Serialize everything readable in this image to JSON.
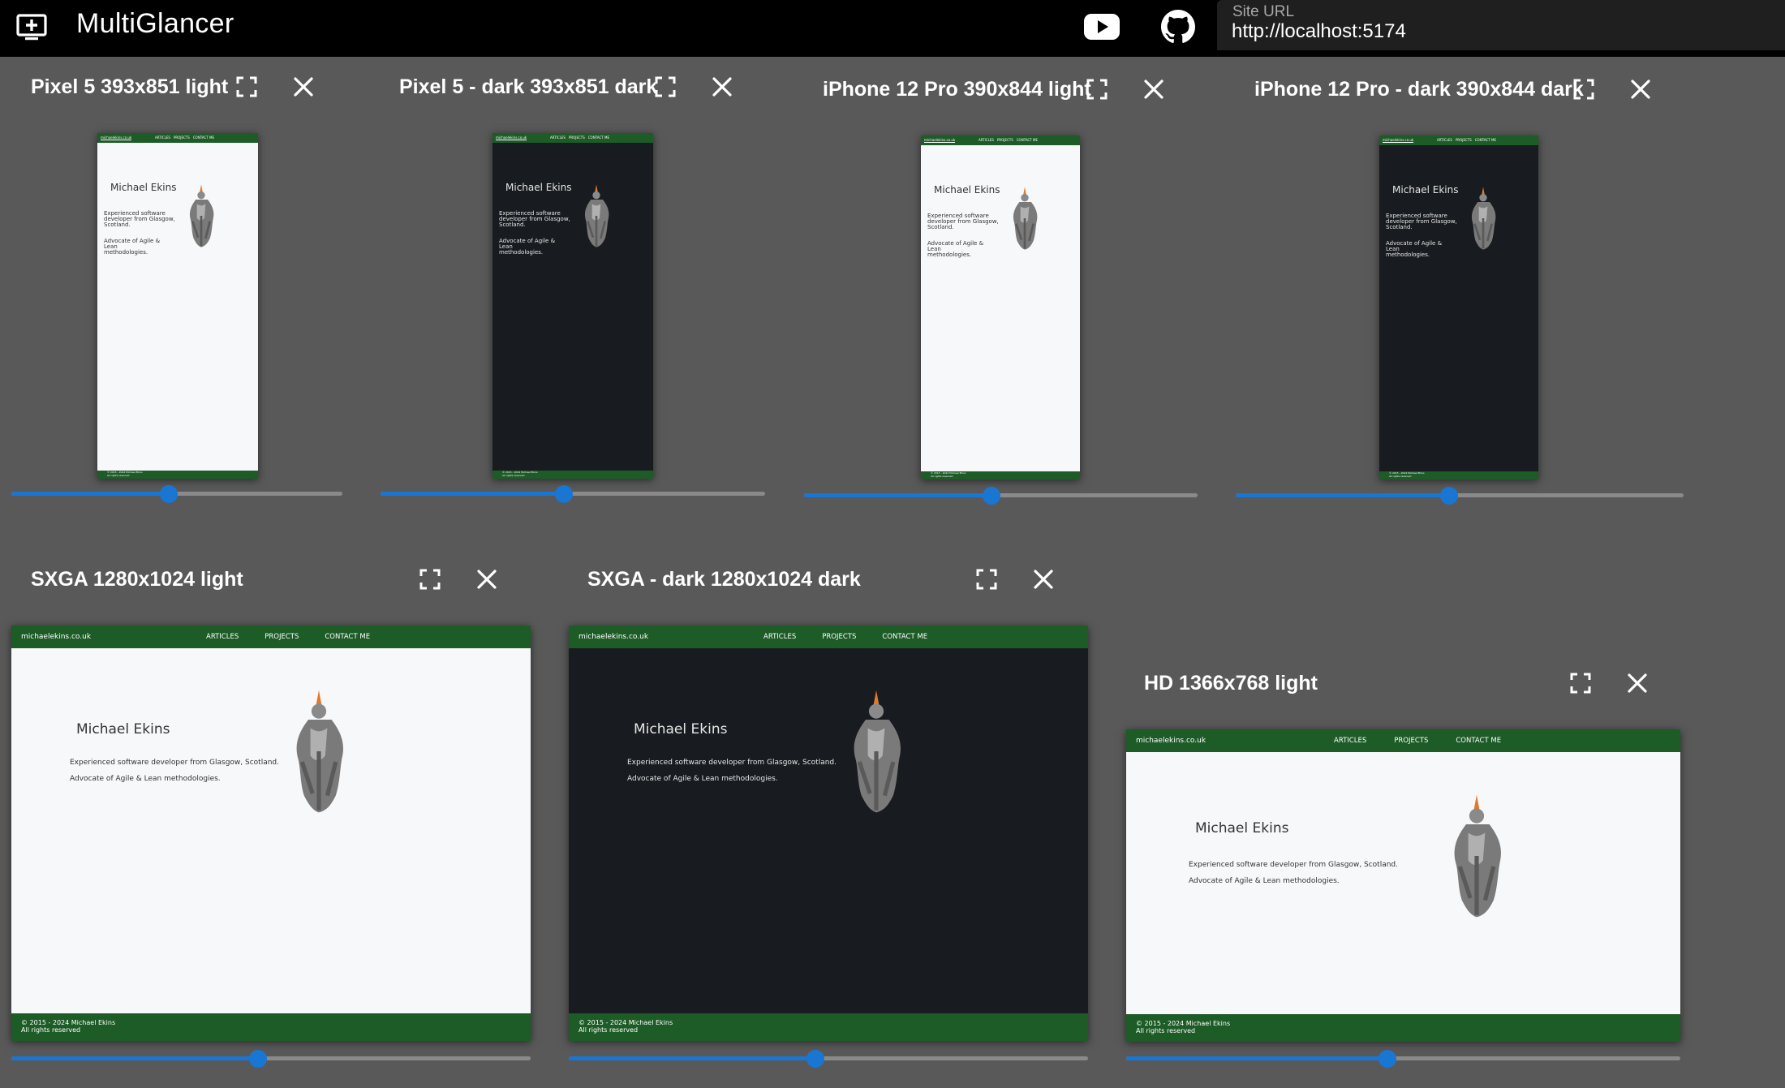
{
  "app": {
    "title": "MultiGlancer",
    "site_url_label": "Site URL",
    "site_url_value": "http://localhost:5174"
  },
  "icons": {
    "logo": "add-to-screen-icon",
    "youtube": "youtube-icon",
    "github": "github-icon",
    "fullscreen": "fullscreen-icon",
    "close": "close-icon"
  },
  "colors": {
    "topbar": "#000000",
    "workspace": "#595959",
    "accent": "#1976d2",
    "site_green": "#1d5b27",
    "site_light_bg": "#f7f8fa",
    "site_dark_bg": "#181b1f"
  },
  "site": {
    "brand": "michaelekins.co.uk",
    "nav": [
      "ARTICLES",
      "PROJECTS",
      "CONTACT ME"
    ],
    "name": "Michael Ekins",
    "intro_mobile": "Experienced software developer from Glasgow, Scotland.",
    "intro_desktop": "Experienced software developer from Glasgow, Scotland.",
    "advocate": "Advocate of Agile & Lean methodologies.",
    "footer_copyright": "© 2015 - 2024 Michael Ekins",
    "footer_rights": "All rights reserved"
  },
  "panels": [
    {
      "title": "Pixel 5 393x851 light",
      "theme": "light",
      "zoom": 0.476
    },
    {
      "title": "Pixel 5 - dark 393x851 dark",
      "theme": "dark",
      "zoom": 0.476
    },
    {
      "title": "iPhone 12 Pro 390x844 light",
      "theme": "light",
      "zoom": 0.476
    },
    {
      "title": "iPhone 12 Pro - dark 390x844 dark",
      "theme": "dark",
      "zoom": 0.476
    },
    {
      "title": "SXGA 1280x1024 light",
      "theme": "light",
      "zoom": 0.475
    },
    {
      "title": "SXGA - dark 1280x1024 dark",
      "theme": "dark",
      "zoom": 0.475
    },
    {
      "title": "HD 1366x768 light",
      "theme": "light",
      "zoom": 0.471
    }
  ]
}
